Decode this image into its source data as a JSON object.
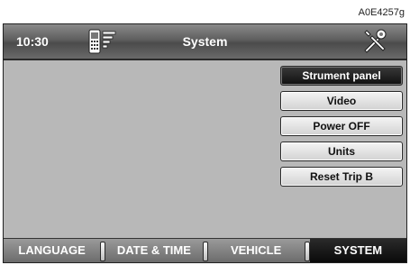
{
  "reference_code": "A0E4257g",
  "header": {
    "time": "10:30",
    "title": "System",
    "left_icon": "phone-signal-icon",
    "right_icon": "tools-icon"
  },
  "menu": {
    "items": [
      {
        "label": "Strument panel",
        "selected": true
      },
      {
        "label": "Video",
        "selected": false
      },
      {
        "label": "Power OFF",
        "selected": false
      },
      {
        "label": "Units",
        "selected": false
      },
      {
        "label": "Reset Trip B",
        "selected": false
      }
    ]
  },
  "tabs": [
    {
      "label": "LANGUAGE",
      "active": false
    },
    {
      "label": "DATE & TIME",
      "active": false
    },
    {
      "label": "VEHICLE",
      "active": false
    },
    {
      "label": "SYSTEM",
      "active": true
    }
  ]
}
